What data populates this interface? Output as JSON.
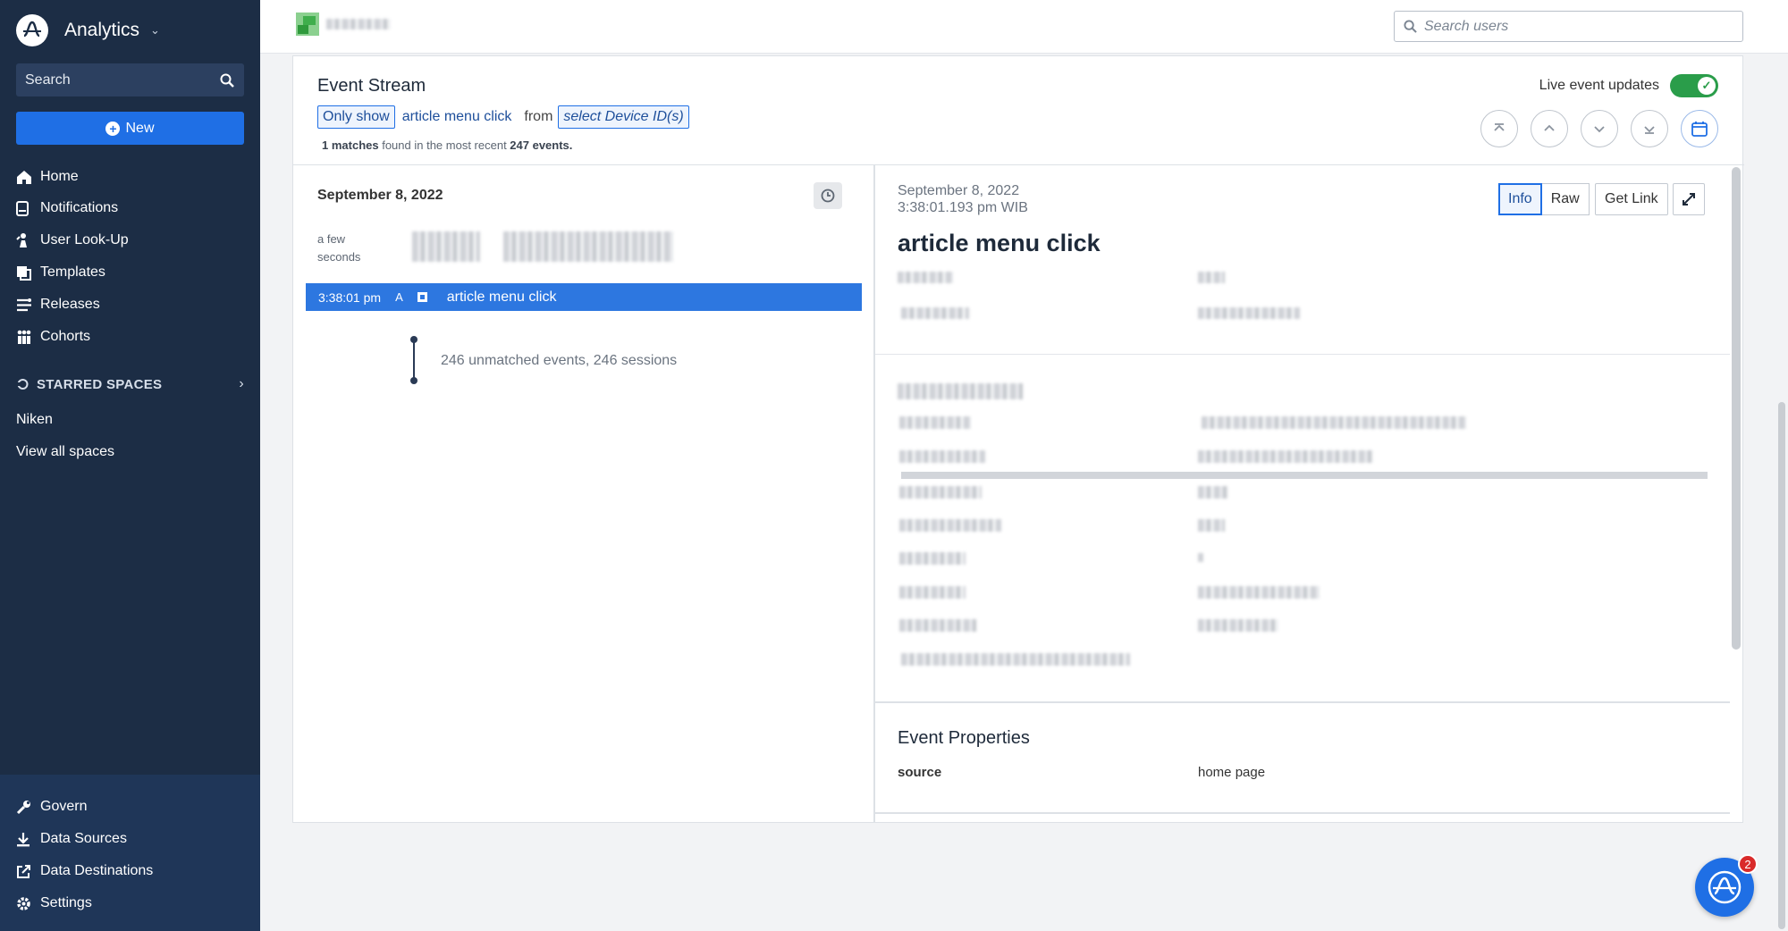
{
  "sidebar": {
    "app_name": "Analytics",
    "search_label": "Search",
    "new_label": "New",
    "nav": [
      {
        "label": "Home",
        "icon": "home-icon"
      },
      {
        "label": "Notifications",
        "icon": "notifications-icon"
      },
      {
        "label": "User Look-Up",
        "icon": "user-lookup-icon"
      },
      {
        "label": "Templates",
        "icon": "templates-icon"
      },
      {
        "label": "Releases",
        "icon": "releases-icon"
      },
      {
        "label": "Cohorts",
        "icon": "cohorts-icon"
      }
    ],
    "starred_spaces_label": "STARRED SPACES",
    "spaces": [
      "Niken",
      "View all spaces"
    ],
    "bottom_nav": [
      {
        "label": "Govern",
        "icon": "wrench-icon"
      },
      {
        "label": "Data Sources",
        "icon": "download-icon"
      },
      {
        "label": "Data Destinations",
        "icon": "export-icon"
      },
      {
        "label": "Settings",
        "icon": "gear-icon"
      }
    ]
  },
  "topbar": {
    "search_placeholder": "Search users"
  },
  "event_stream": {
    "title": "Event Stream",
    "filter": {
      "only_show": "Only show",
      "event": "article menu click",
      "from": "from",
      "device": "select Device ID(s)"
    },
    "matches_count": "1 matches",
    "matches_mid": " found in the most recent ",
    "events_count": "247 events.",
    "live_label": "Live event updates",
    "live_on": true
  },
  "left_pane": {
    "date": "September 8, 2022",
    "relative_time": "a few seconds",
    "event_time": "3:38:01 pm",
    "event_platform": "A",
    "event_name": "article menu click",
    "unmatched": "246 unmatched events, 246 sessions"
  },
  "right_pane": {
    "date": "September 8, 2022",
    "time": "3:38:01.193 pm WIB",
    "info_label": "Info",
    "raw_label": "Raw",
    "get_link_label": "Get Link",
    "title": "article menu click",
    "event_properties_title": "Event Properties",
    "properties": [
      {
        "key": "source",
        "value": "home page"
      }
    ]
  },
  "fab": {
    "badge": "2"
  },
  "colors": {
    "sidebar_bg": "#1c2d45",
    "accent": "#1f6fe5",
    "toggle_on": "#2a9d4a",
    "badge": "#d92a2a"
  }
}
